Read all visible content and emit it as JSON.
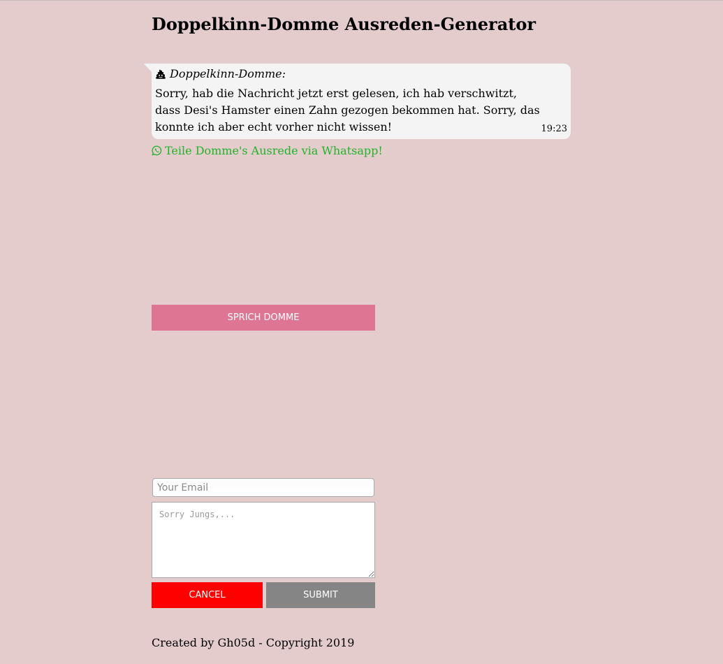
{
  "header": {
    "title": "Doppelkinn-Domme Ausreden-Generator"
  },
  "message": {
    "icon": "poo-icon",
    "sender": "Doppelkinn-Domme:",
    "text": "Sorry, hab die Nachricht jetzt erst gelesen, ich hab verschwitzt, dass Desi's Hamster einen Zahn gezogen bekommen hat. Sorry, das konnte ich aber echt vorher nicht wissen!",
    "time": "19:23"
  },
  "share": {
    "icon": "whatsapp-icon",
    "label": "Teile Domme's Ausrede via Whatsapp!",
    "color": "#22b22a"
  },
  "actions": {
    "speak_label": "Sprich Domme",
    "speak_color": "#dd7593"
  },
  "form": {
    "email_placeholder": "Your Email",
    "message_placeholder": "Sorry Jungs,...",
    "cancel_label": "Cancel",
    "cancel_color": "#ff0000",
    "submit_label": "Submit",
    "submit_color": "#858585"
  },
  "footer": {
    "text": "Created by Gh05d - Copyright 2019"
  },
  "colors": {
    "background": "#e4cccd",
    "bubble": "#f4f4f4"
  }
}
